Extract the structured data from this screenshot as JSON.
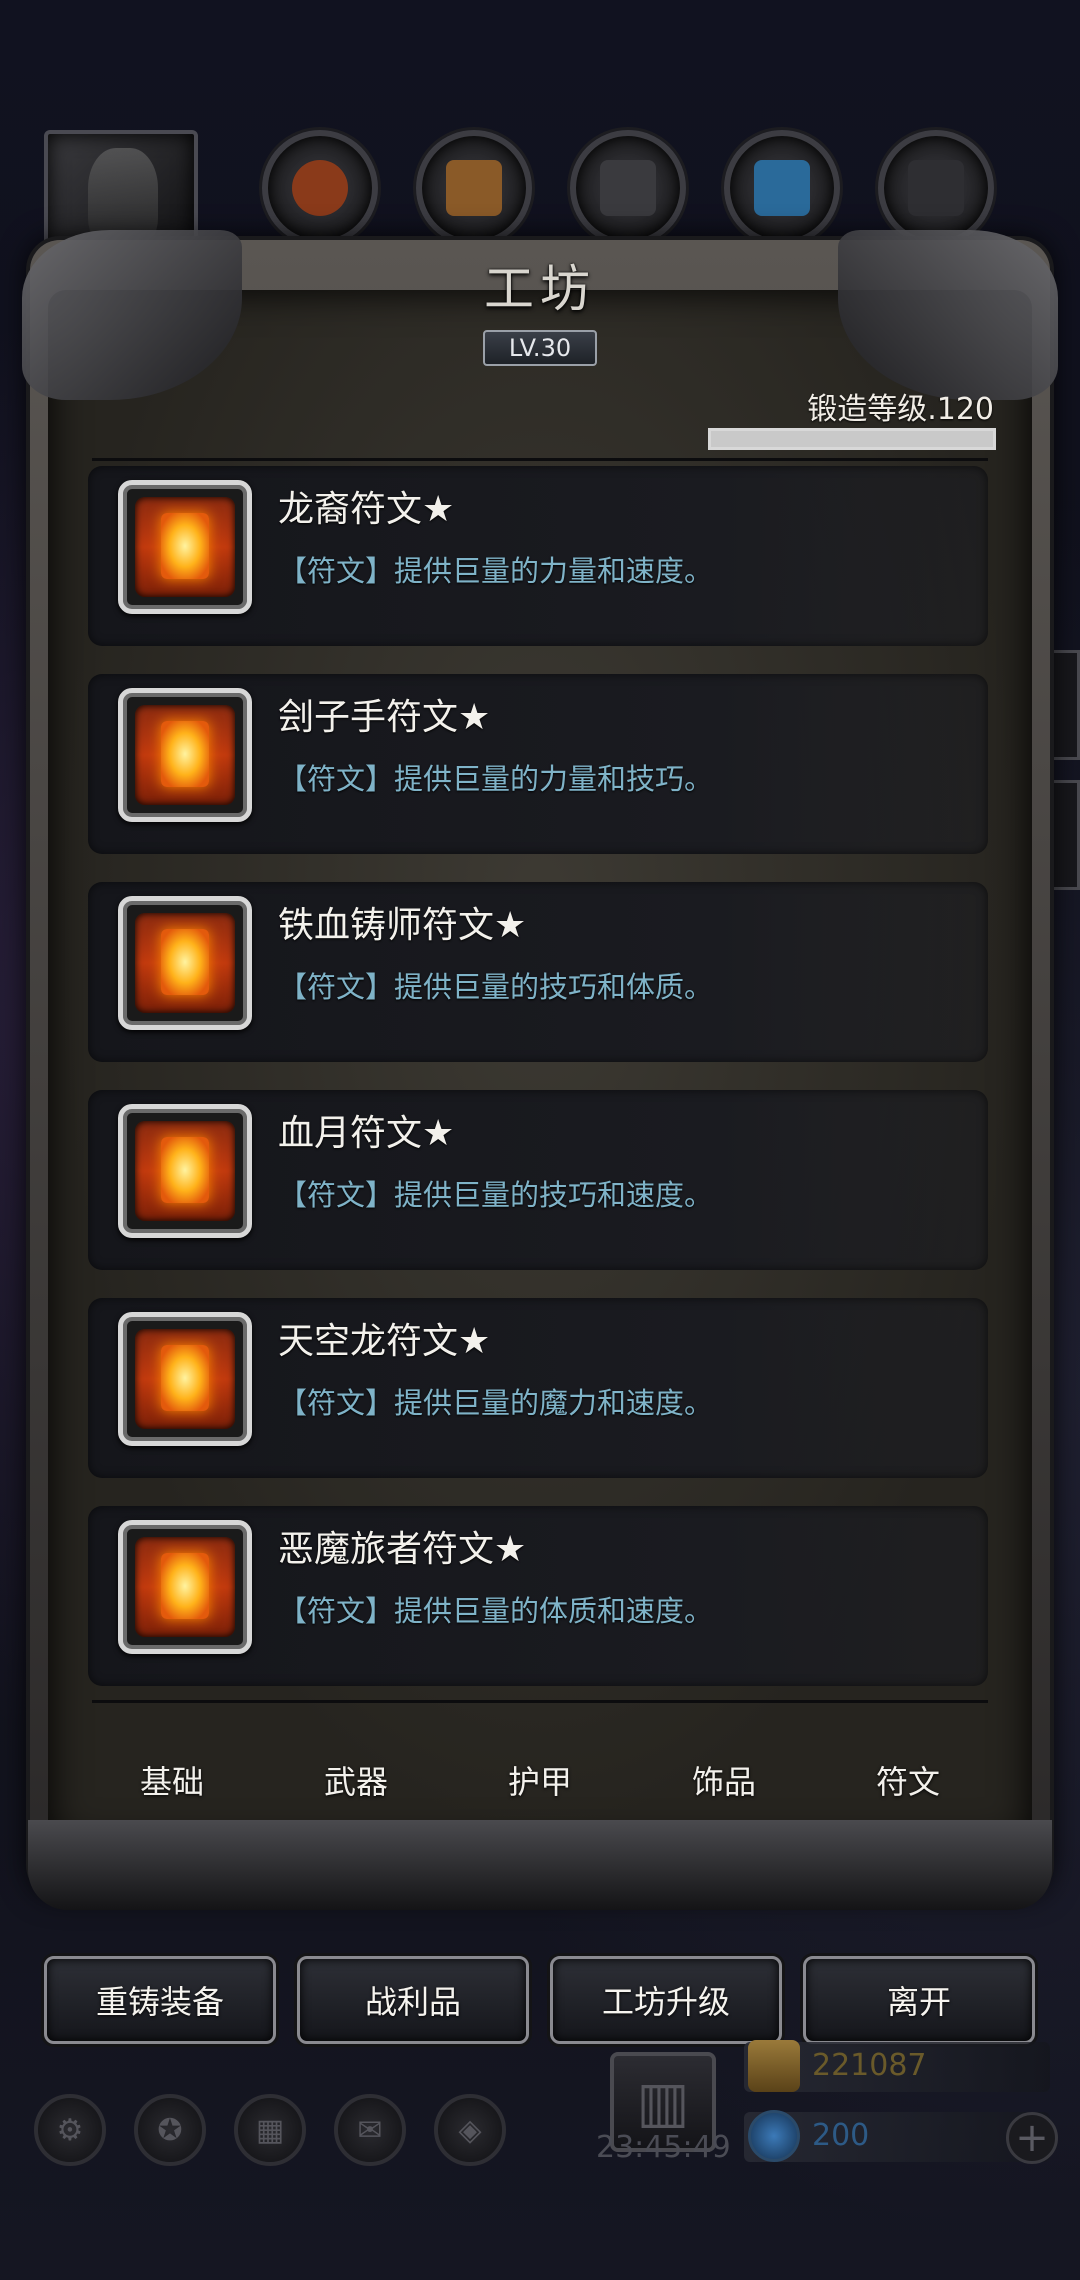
{
  "workshop": {
    "title": "工坊",
    "level": "LV.30",
    "forge_level_label": "锻造等级.120",
    "forge_progress": 1.0
  },
  "top_slots": [
    {
      "icon": "meat-icon",
      "color": "#8a3a1a"
    },
    {
      "icon": "wood-icon",
      "color": "#8a5a28"
    },
    {
      "icon": "iron-icon",
      "color": "#3a3a3e"
    },
    {
      "icon": "crystal-icon",
      "color": "#2a6a9a"
    },
    {
      "icon": "steel-icon",
      "color": "#2e2e32"
    }
  ],
  "runes": [
    {
      "name": "龙裔符文★",
      "desc": "【符文】提供巨量的力量和速度。"
    },
    {
      "name": "刽子手符文★",
      "desc": "【符文】提供巨量的力量和技巧。"
    },
    {
      "name": "铁血铸师符文★",
      "desc": "【符文】提供巨量的技巧和体质。"
    },
    {
      "name": "血月符文★",
      "desc": "【符文】提供巨量的技巧和速度。"
    },
    {
      "name": "天空龙符文★",
      "desc": "【符文】提供巨量的魔力和速度。"
    },
    {
      "name": "恶魔旅者符文★",
      "desc": "【符文】提供巨量的体质和速度。"
    }
  ],
  "tabs": [
    "基础",
    "武器",
    "护甲",
    "饰品",
    "符文"
  ],
  "actions": [
    "重铸装备",
    "战利品",
    "工坊升级",
    "离开"
  ],
  "hud": {
    "clock": "23:45:49",
    "gold": "221087",
    "gems": "200",
    "gold_color": "#6a5a2a",
    "gem_color": "#2d5a86"
  }
}
